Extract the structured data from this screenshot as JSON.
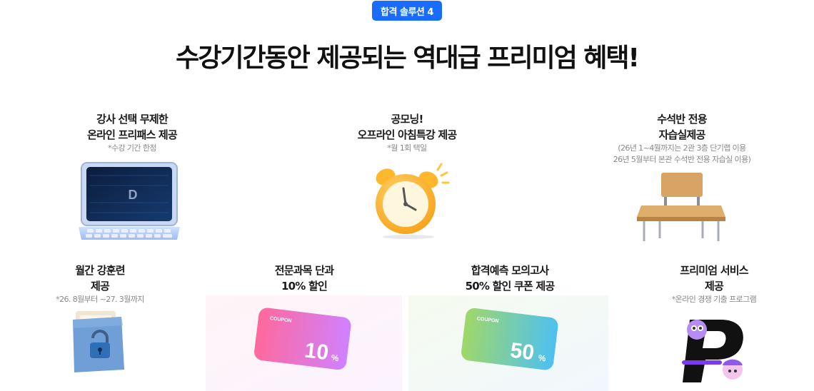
{
  "header": {
    "badge": "합격 솔루션 4",
    "title": "수강기간동안 제공되는 역대급 프리미엄 혜택!"
  },
  "benefits": [
    {
      "line1": "강사 선택 무제한",
      "line2": "온라인 프리패스 제공",
      "note1": "*수강 기간 한정",
      "note2": "",
      "illustration": "laptop-icon"
    },
    {
      "line1": "공모닝!",
      "line2": "오프라인 아침특강 제공",
      "note1": "*월 1회 택일",
      "note2": "",
      "illustration": "alarm-clock-icon"
    },
    {
      "line1": "수석반 전용",
      "line2": "자습실제공",
      "note1": "(26년 1~4월까지는 2관 3층 단기랩 이용",
      "note2": "26년 5월부터 본관 수석반 전용 자습실 이용)",
      "illustration": "desk-icon"
    },
    {
      "line1": "월간 강훈련",
      "line2": "제공",
      "note1": "*26. 8월부터 ~27. 3월까지",
      "note2": "",
      "illustration": "locked-folder-icon"
    },
    {
      "line1": "전문과목 단과",
      "line2": "10% 할인",
      "note1": "",
      "note2": "",
      "illustration": "coupon-icon"
    },
    {
      "line1": "합격예측 모의고사",
      "line2": "50% 할인 쿠폰 제공",
      "note1": "",
      "note2": "",
      "illustration": "coupon-icon"
    },
    {
      "line1": "프리미엄 서비스",
      "line2": "제공",
      "note1": "*온라인 경쟁 기출 프로그램",
      "note2": "",
      "illustration": "p-logo-icon"
    }
  ],
  "coupons": [
    {
      "label": "COUPON",
      "value": "10",
      "unit": "%",
      "color_from": "#ff4f8b",
      "color_to": "#c86bff"
    },
    {
      "label": "COUPON",
      "value": "50",
      "unit": "%",
      "color_from": "#8fd14f",
      "color_to": "#2fb6f0"
    }
  ],
  "logo": {
    "letter": "D"
  },
  "colors": {
    "badge": "#1a6cff",
    "heading": "#111111",
    "note": "#888888"
  }
}
